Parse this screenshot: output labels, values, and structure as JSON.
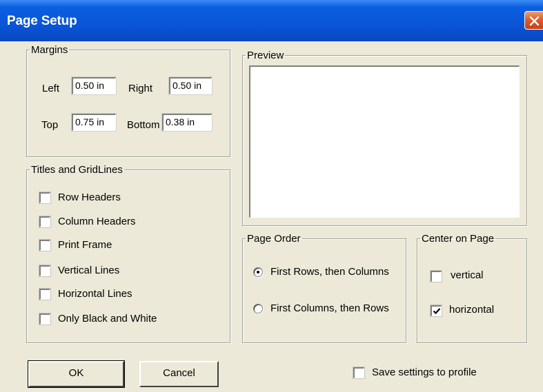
{
  "window": {
    "title": "Page Setup"
  },
  "margins": {
    "legend": "Margins",
    "left_label": "Left",
    "left_value": "0.50 in",
    "right_label": "Right",
    "right_value": "0.50 in",
    "top_label": "Top",
    "top_value": "0.75 in",
    "bottom_label": "Bottom",
    "bottom_value": "0.38 in"
  },
  "titles": {
    "legend": "Titles and GridLines",
    "items": [
      {
        "label": "Row Headers",
        "checked": false
      },
      {
        "label": "Column Headers",
        "checked": false
      },
      {
        "label": "Print Frame",
        "checked": false
      },
      {
        "label": "Vertical Lines",
        "checked": false
      },
      {
        "label": "Horizontal Lines",
        "checked": false
      },
      {
        "label": "Only Black and White",
        "checked": false
      }
    ]
  },
  "preview": {
    "legend": "Preview"
  },
  "page_order": {
    "legend": "Page Order",
    "options": [
      {
        "label": "First Rows, then Columns",
        "selected": true
      },
      {
        "label": "First Columns, then Rows",
        "selected": false
      }
    ]
  },
  "center": {
    "legend": "Center on Page",
    "options": [
      {
        "label": "vertical",
        "checked": false
      },
      {
        "label": "horizontal",
        "checked": true
      }
    ]
  },
  "footer": {
    "ok_label": "OK",
    "cancel_label": "Cancel",
    "save_label": "Save settings to profile",
    "save_checked": false
  },
  "colors": {
    "titlebar": "#0a55d8",
    "dialog_bg": "#ece9d8",
    "close_button": "#e05a2a"
  }
}
